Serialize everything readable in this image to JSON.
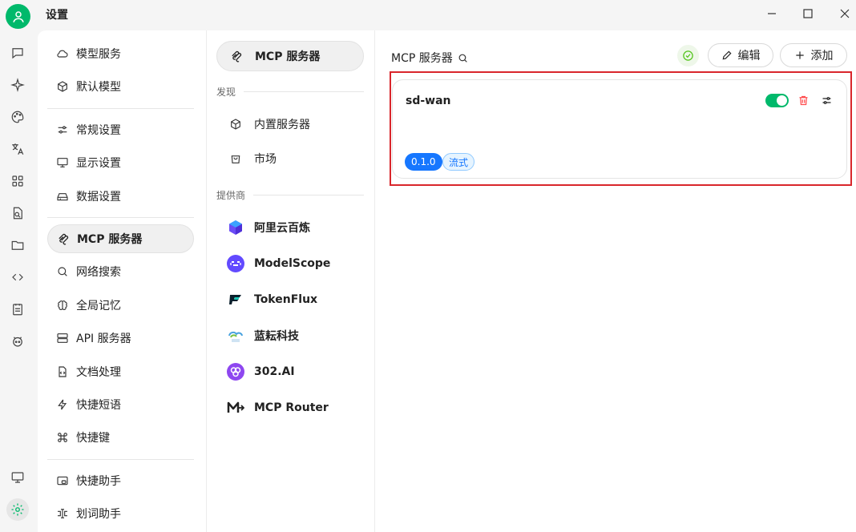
{
  "window": {
    "title": "设置",
    "controls": [
      "minimize-icon",
      "maximize-icon",
      "close-icon"
    ]
  },
  "rail": {
    "icons": [
      "chat-icon",
      "sparkle-icon",
      "palette-icon",
      "translate-icon",
      "apps-grid-icon",
      "file-search-icon",
      "folder-icon",
      "code-icon",
      "notes-icon",
      "bot-icon",
      "monitor-icon",
      "settings-icon"
    ],
    "active": "settings-icon"
  },
  "settings_nav": {
    "items": [
      {
        "label": "模型服务",
        "icon": "cloud-icon"
      },
      {
        "label": "默认模型",
        "icon": "cube-icon"
      },
      {
        "label": "常规设置",
        "icon": "sliders-icon"
      },
      {
        "label": "显示设置",
        "icon": "display-icon"
      },
      {
        "label": "数据设置",
        "icon": "drive-icon"
      },
      {
        "label": "MCP 服务器",
        "icon": "mcp-icon",
        "active": true
      },
      {
        "label": "网络搜索",
        "icon": "search-icon"
      },
      {
        "label": "全局记忆",
        "icon": "brain-icon"
      },
      {
        "label": "API 服务器",
        "icon": "server-icon"
      },
      {
        "label": "文档处理",
        "icon": "document-code-icon"
      },
      {
        "label": "快捷短语",
        "icon": "bolt-icon"
      },
      {
        "label": "快捷键",
        "icon": "command-icon"
      },
      {
        "label": "快捷助手",
        "icon": "assistant-window-icon"
      },
      {
        "label": "划词助手",
        "icon": "text-cursor-icon"
      }
    ]
  },
  "mcp_nav": {
    "top": {
      "label": "MCP 服务器",
      "icon": "mcp-icon"
    },
    "discover_label": "发现",
    "discover": [
      {
        "label": "内置服务器",
        "icon": "package-icon"
      },
      {
        "label": "市场",
        "icon": "shopping-bag-icon"
      }
    ],
    "providers_label": "提供商",
    "providers": [
      {
        "label": "阿里云百炼",
        "icon": "bailian-logo-icon"
      },
      {
        "label": "ModelScope",
        "icon": "modelscope-logo-icon"
      },
      {
        "label": "TokenFlux",
        "icon": "tokenflux-logo-icon"
      },
      {
        "label": "蓝耘科技",
        "icon": "lanyun-logo-icon"
      },
      {
        "label": "302.AI",
        "icon": "302ai-logo-icon"
      },
      {
        "label": "MCP Router",
        "icon": "mcp-router-logo-icon"
      }
    ]
  },
  "main": {
    "title": "MCP 服务器",
    "edit_label": "编辑",
    "add_label": "添加",
    "server": {
      "name": "sd-wan",
      "enabled": true,
      "version": "0.1.0",
      "type_tag": "流式"
    }
  },
  "colors": {
    "accent": "#00b96b",
    "tag_blue": "#1677ff",
    "highlight_red": "#d9262c",
    "delete_red": "#ff4d4f"
  }
}
